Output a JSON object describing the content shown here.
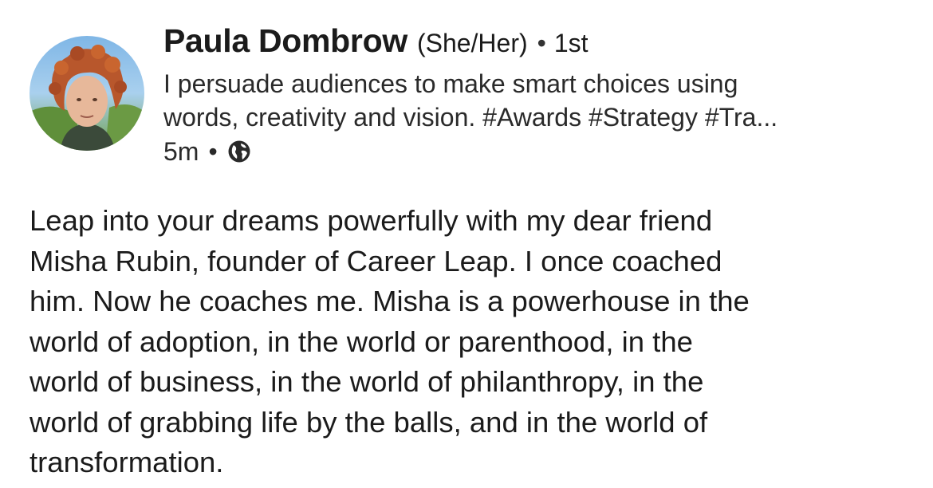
{
  "author": {
    "name": "Paula Dombrow",
    "pronouns": "(She/Her)",
    "separator": "•",
    "connection_degree": "1st",
    "headline_lines": [
      "I persuade audiences to make smart choices using",
      "words, creativity and vision. #Awards #Strategy #Tra..."
    ],
    "avatar_icon": "profile-photo"
  },
  "meta": {
    "time_ago": "5m",
    "separator": "•",
    "visibility_icon": "globe-icon"
  },
  "post": {
    "lines": [
      "Leap into your dreams powerfully with my dear friend",
      "Misha Rubin, founder of Career Leap. I once coached",
      "him. Now he coaches me. Misha is a powerhouse in the",
      "world of adoption, in the world or parenthood, in the",
      "world of business, in the world of philanthropy, in the",
      "world of grabbing life by the balls, and in the world of",
      "transformation."
    ]
  },
  "colors": {
    "text": "#1b1b1b",
    "background": "#ffffff"
  }
}
